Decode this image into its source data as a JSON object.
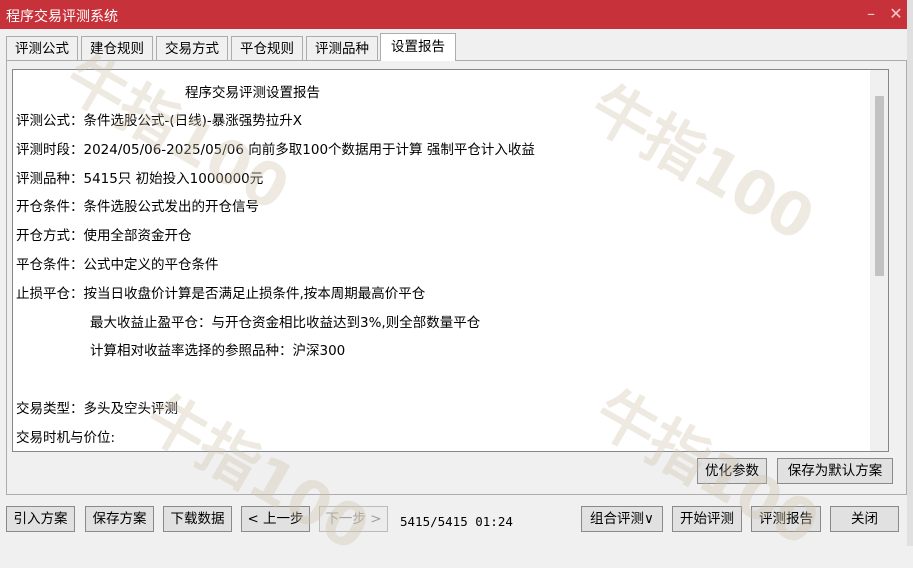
{
  "window": {
    "title": "程序交易评测系统"
  },
  "tabs": [
    {
      "label": "评测公式"
    },
    {
      "label": "建仓规则"
    },
    {
      "label": "交易方式"
    },
    {
      "label": "平仓规则"
    },
    {
      "label": "评测品种"
    },
    {
      "label": "设置报告"
    }
  ],
  "report": {
    "heading": "程序交易评测设置报告",
    "formula": "评测公式：条件选股公式-(日线)-暴涨强势拉升X",
    "period": "评测时段：2024/05/06-2025/05/06 向前多取100个数据用于计算 强制平仓计入收益",
    "symbols": "评测品种：5415只 初始投入1000000元",
    "open_condition": "开仓条件：条件选股公式发出的开仓信号",
    "open_method": "开仓方式：使用全部资金开仓",
    "close_condition": "平仓条件：公式中定义的平仓条件",
    "stop_loss": "止损平仓：按当日收盘价计算是否满足止损条件,按本周期最高价平仓",
    "take_profit": "最大收益止盈平仓：与开仓资金相比收益达到3%,则全部数量平仓",
    "benchmark": "计算相对收益率选择的参照品种：沪深300",
    "trade_type": "交易类型：多头及空头评测",
    "trade_timing": "交易时机与价位:"
  },
  "panel_buttons": {
    "optimize": "优化参数",
    "save_default": "保存为默认方案"
  },
  "bottom": {
    "import": "引入方案",
    "save": "保存方案",
    "download": "下载数据",
    "prev": "< 上一步",
    "next": "下一步 >",
    "progress_text": "5415/5415 01:24",
    "combo": "组合评测∨",
    "start": "开始评测",
    "report": "评测报告",
    "close": "关闭"
  },
  "watermark": "牛指100"
}
